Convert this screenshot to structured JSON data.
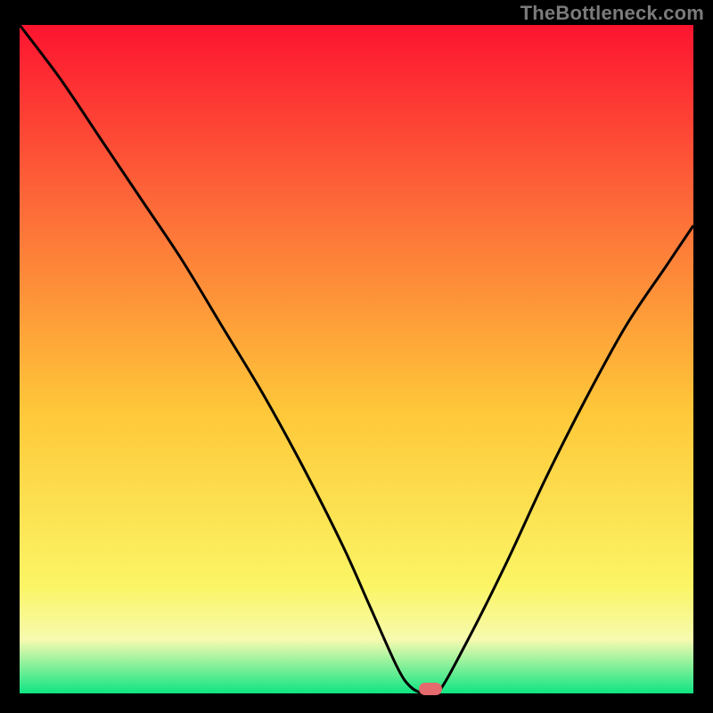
{
  "watermark": "TheBottleneck.com",
  "colors": {
    "gradient_top": "#fd1430",
    "gradient_mid_upper": "#fd6d39",
    "gradient_mid": "#fec839",
    "gradient_mid_lower": "#fbf565",
    "gradient_band": "#f6faaf",
    "gradient_bottom": "#0ee583",
    "curve": "#000000",
    "marker": "#e46a6d",
    "frame": "#000000"
  },
  "chart_data": {
    "type": "line",
    "title": "",
    "xlabel": "",
    "ylabel": "",
    "xlim": [
      0,
      100
    ],
    "ylim": [
      0,
      100
    ],
    "legend": false,
    "grid": false,
    "series": [
      {
        "name": "bottleneck-curve",
        "x": [
          0,
          6,
          12,
          18,
          24,
          30,
          36,
          42,
          48,
          52,
          56,
          58,
          60,
          62,
          66,
          72,
          78,
          84,
          90,
          96,
          100
        ],
        "y": [
          100,
          92,
          83,
          74,
          65,
          55,
          45,
          34,
          22,
          13,
          4,
          1,
          0,
          0,
          7,
          19,
          32,
          44,
          55,
          64,
          70
        ]
      }
    ],
    "marker": {
      "x": 61,
      "y": 0
    },
    "annotations": []
  }
}
